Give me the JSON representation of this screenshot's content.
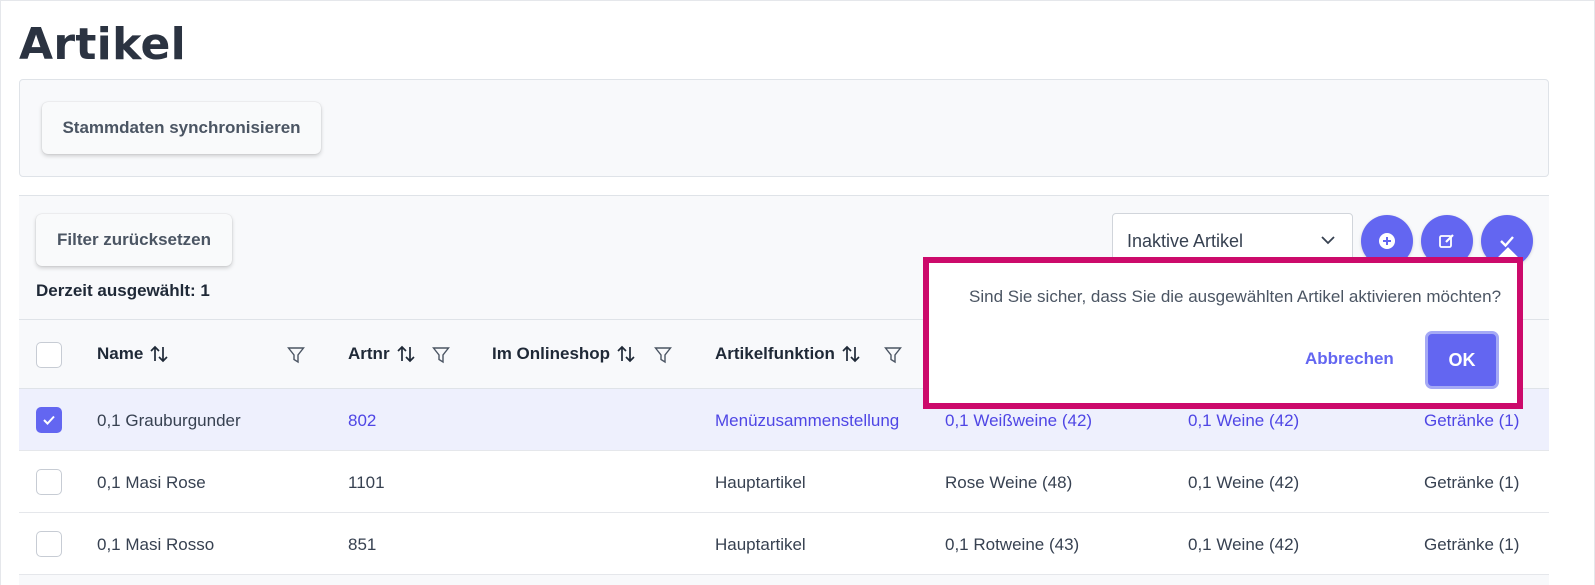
{
  "page": {
    "title": "Artikel"
  },
  "toolbar": {
    "sync_label": "Stammdaten synchronisieren"
  },
  "table_toolbar": {
    "reset_label": "Filter zurücksetzen",
    "selected_text": "Derzeit ausgewählt: 1",
    "select_value": "Inaktive Artikel",
    "buttons": [
      "plus-circle-icon",
      "edit-icon",
      "check-icon"
    ]
  },
  "columns": [
    {
      "label": "Name",
      "sortable": true,
      "filter": true
    },
    {
      "label": "Artnr",
      "sortable": true,
      "filter": true
    },
    {
      "label": "Im Onlineshop",
      "sortable": true,
      "filter": true
    },
    {
      "label": "Artikelfunktion",
      "sortable": true,
      "filter": true
    }
  ],
  "rows": [
    {
      "checked": true,
      "name": "0,1 Grauburgunder",
      "artnr": "802",
      "funktion": "Menüzusammenstellung",
      "gruppe": "0,1 Weißweine (42)",
      "obergruppe": "0,1 Weine (42)",
      "kategorie": "Getränke (1)"
    },
    {
      "checked": false,
      "name": "0,1 Masi Rose",
      "artnr": "1101",
      "funktion": "Hauptartikel",
      "gruppe": "Rose Weine (48)",
      "obergruppe": "0,1 Weine (42)",
      "kategorie": "Getränke (1)"
    },
    {
      "checked": false,
      "name": "0,1 Masi Rosso",
      "artnr": "851",
      "funktion": "Hauptartikel",
      "gruppe": "0,1 Rotweine (43)",
      "obergruppe": "0,1 Weine (42)",
      "kategorie": "Getränke (1)"
    }
  ],
  "popup": {
    "message": "Sind Sie sicher, dass Sie die ausgewählten Artikel aktivieren möchten?",
    "cancel_label": "Abbrechen",
    "ok_label": "OK"
  },
  "colors": {
    "accent": "#6366f1",
    "highlight_frame": "#cc0a6b",
    "selected_row": "#eef0fd"
  }
}
